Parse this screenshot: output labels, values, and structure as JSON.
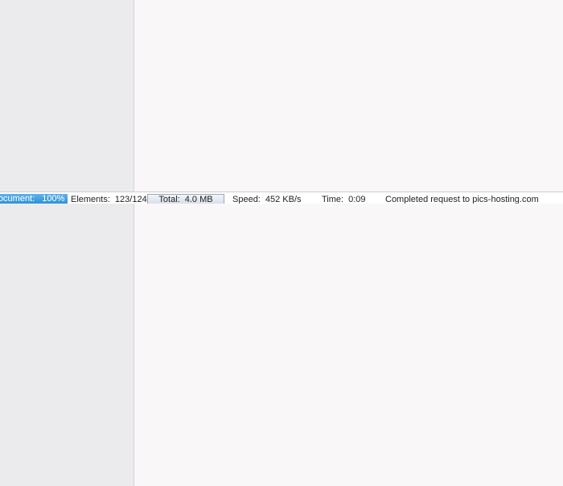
{
  "statusbar": {
    "document_label": "Document:",
    "document_value": "100%",
    "document_progress": 1.0,
    "elements_label": "Elements:",
    "elements_value": "123/124",
    "total_label": "Total:",
    "total_value": "4.0 MB",
    "speed_label": "Speed:",
    "speed_value": "452 KB/s",
    "time_label": "Time:",
    "time_value": "0:09",
    "message": "Completed request to pics-hosting.com"
  },
  "colors": {
    "background": "#f9f7f8",
    "sidebar": "#ebebed",
    "progress_fill": "#2b8fd6"
  }
}
